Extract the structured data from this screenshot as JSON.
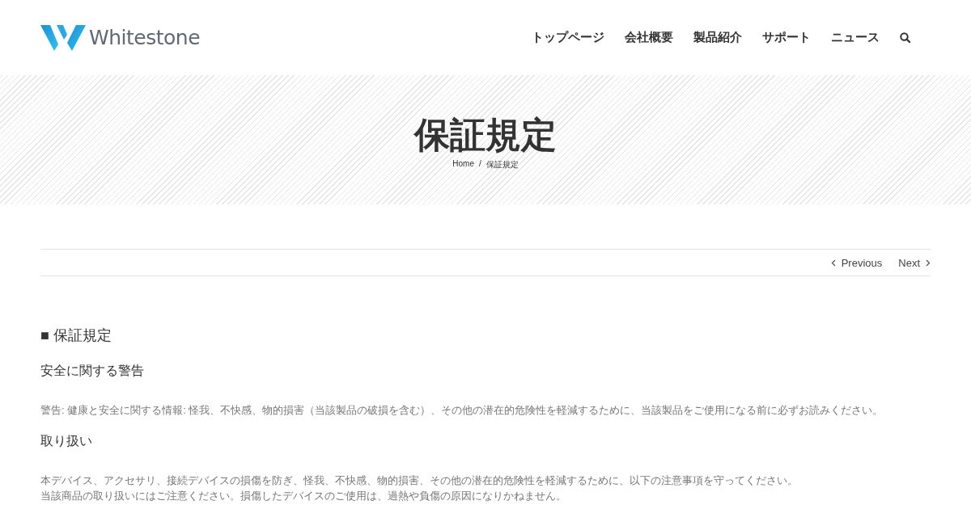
{
  "header": {
    "logo_text": "Whitestone",
    "nav": [
      {
        "label": "トップページ"
      },
      {
        "label": "会社概要"
      },
      {
        "label": "製品紹介"
      },
      {
        "label": "サポート"
      },
      {
        "label": "ニュース"
      }
    ]
  },
  "banner": {
    "title": "保証規定",
    "breadcrumb": [
      "Home",
      "保証規定"
    ],
    "separator": "/"
  },
  "pager": {
    "previous": "Previous",
    "next": "Next"
  },
  "content": [
    {
      "kind": "heading",
      "text": "■ 保証規定"
    },
    {
      "kind": "subheading",
      "text": "安全に関する警告"
    },
    {
      "kind": "paragraph",
      "lines": [
        "警告: 健康と安全に関する情報: 怪我、不快感、物的損害（当該製品の破損を含む）、その他の潜在的危険性を軽減するために、当該製品をご使用になる前に必ずお読みください。"
      ]
    },
    {
      "kind": "subheading",
      "text": "取り扱い"
    },
    {
      "kind": "paragraph",
      "lines": [
        "本デバイス、アクセサリ、接続デバイスの損傷を防ぎ、怪我、不快感、物的損害、その他の潜在的危険性を軽減するために、以下の注意事項を守ってください。",
        "当該商品の取り扱いにはご注意ください。損傷したデバイスのご使用は、過熱や負傷の原因になりかねません。"
      ]
    }
  ]
}
